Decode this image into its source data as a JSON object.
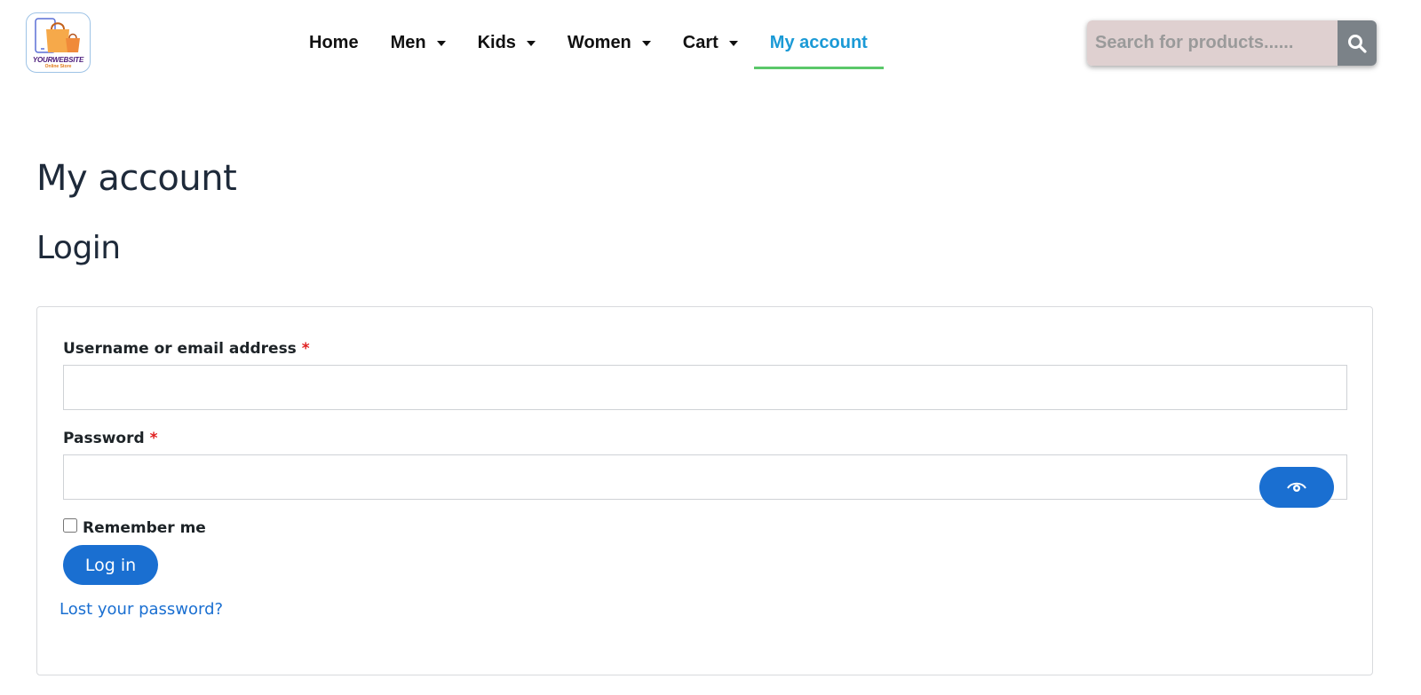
{
  "header": {
    "logo": {
      "name": "YOURWEBSITE",
      "tagline": "Online Store",
      "icon": "shopping-bag-icon"
    },
    "nav": {
      "items": [
        {
          "label": "Home",
          "has_dropdown": false,
          "active": false
        },
        {
          "label": "Men",
          "has_dropdown": true,
          "active": false
        },
        {
          "label": "Kids",
          "has_dropdown": true,
          "active": false
        },
        {
          "label": "Women",
          "has_dropdown": true,
          "active": false
        },
        {
          "label": "Cart",
          "has_dropdown": true,
          "active": false
        },
        {
          "label": "My account",
          "has_dropdown": false,
          "active": true
        }
      ],
      "active_color": "#1b9ad6",
      "active_underline_color": "#5bc86a"
    },
    "search": {
      "placeholder": "Search for products......",
      "value": "",
      "icon": "search-icon"
    }
  },
  "page": {
    "title": "My account",
    "section_title": "Login"
  },
  "login_form": {
    "username_label": "Username or email address",
    "password_label": "Password",
    "required_mark": "*",
    "username_value": "",
    "password_value": "",
    "show_password_icon": "eye-icon",
    "remember_label": "Remember me",
    "remember_checked": false,
    "submit_label": "Log in",
    "lost_password_label": "Lost your password?",
    "accent_color": "#1a6fd1"
  }
}
